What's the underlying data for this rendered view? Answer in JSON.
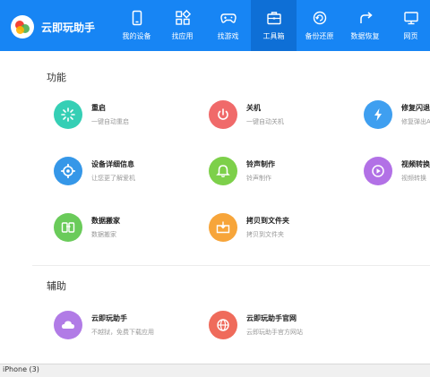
{
  "app": {
    "brand": "云即玩助手"
  },
  "nav": [
    {
      "label": "我的设备",
      "icon": "phone-icon"
    },
    {
      "label": "找应用",
      "icon": "apps-grid-icon"
    },
    {
      "label": "找游戏",
      "icon": "gamepad-icon"
    },
    {
      "label": "工具箱",
      "icon": "toolbox-icon",
      "active": true
    },
    {
      "label": "备份还原",
      "icon": "backup-icon"
    },
    {
      "label": "数据恢复",
      "icon": "restore-icon"
    },
    {
      "label": "网页",
      "icon": "monitor-icon"
    }
  ],
  "sections": {
    "functions": {
      "title": "功能",
      "tools": [
        {
          "name": "重启",
          "desc": "一键自动重启",
          "icon": "restart-icon",
          "color": "#35cfb5"
        },
        {
          "name": "关机",
          "desc": "一键自动关机",
          "icon": "power-icon",
          "color": "#f06a6a"
        },
        {
          "name": "修复闪退/",
          "desc": "修复弹出A",
          "icon": "lightning-icon",
          "color": "#3f9ff0"
        },
        {
          "name": "设备详细信息",
          "desc": "让您更了解爱机",
          "icon": "gear-icon",
          "color": "#3597e8"
        },
        {
          "name": "铃声制作",
          "desc": "铃声制作",
          "icon": "bell-icon",
          "color": "#7dd04a"
        },
        {
          "name": "视频转换",
          "desc": "视频转换",
          "icon": "video-convert-icon",
          "color": "#b271e6"
        },
        {
          "name": "数据搬家",
          "desc": "数据搬家",
          "icon": "data-transfer-icon",
          "color": "#6acb5a"
        },
        {
          "name": "拷贝到文件夹",
          "desc": "拷贝到文件夹",
          "icon": "copy-folder-icon",
          "color": "#f7a53a"
        }
      ]
    },
    "assist": {
      "title": "辅助",
      "tools": [
        {
          "name": "云即玩助手",
          "desc": "不越狱，免费下载应用",
          "icon": "cloud-icon",
          "color": "#b17be6"
        },
        {
          "name": "云即玩助手官网",
          "desc": "云即玩助手官方网站",
          "icon": "globe-icon",
          "color": "#ef6b5b"
        }
      ]
    }
  },
  "status": {
    "text": "iPhone (3)"
  }
}
